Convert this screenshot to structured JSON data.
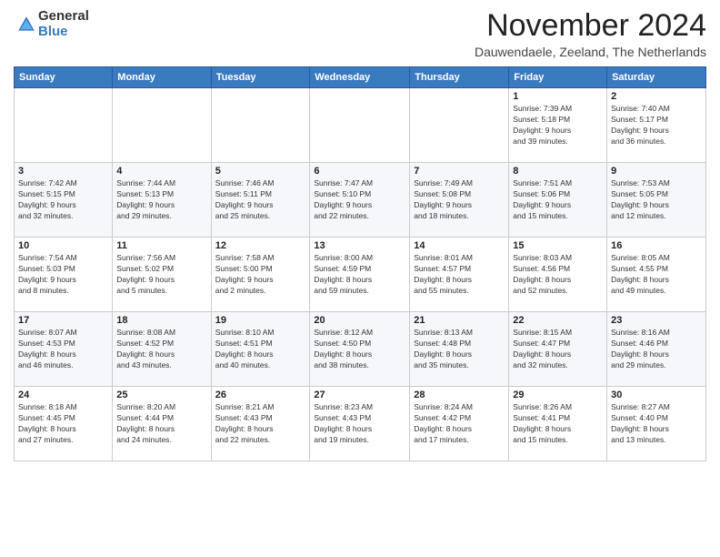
{
  "logo": {
    "general": "General",
    "blue": "Blue"
  },
  "header": {
    "month": "November 2024",
    "location": "Dauwendaele, Zeeland, The Netherlands"
  },
  "weekdays": [
    "Sunday",
    "Monday",
    "Tuesday",
    "Wednesday",
    "Thursday",
    "Friday",
    "Saturday"
  ],
  "weeks": [
    [
      {
        "day": "",
        "info": ""
      },
      {
        "day": "",
        "info": ""
      },
      {
        "day": "",
        "info": ""
      },
      {
        "day": "",
        "info": ""
      },
      {
        "day": "",
        "info": ""
      },
      {
        "day": "1",
        "info": "Sunrise: 7:39 AM\nSunset: 5:18 PM\nDaylight: 9 hours\nand 39 minutes."
      },
      {
        "day": "2",
        "info": "Sunrise: 7:40 AM\nSunset: 5:17 PM\nDaylight: 9 hours\nand 36 minutes."
      }
    ],
    [
      {
        "day": "3",
        "info": "Sunrise: 7:42 AM\nSunset: 5:15 PM\nDaylight: 9 hours\nand 32 minutes."
      },
      {
        "day": "4",
        "info": "Sunrise: 7:44 AM\nSunset: 5:13 PM\nDaylight: 9 hours\nand 29 minutes."
      },
      {
        "day": "5",
        "info": "Sunrise: 7:46 AM\nSunset: 5:11 PM\nDaylight: 9 hours\nand 25 minutes."
      },
      {
        "day": "6",
        "info": "Sunrise: 7:47 AM\nSunset: 5:10 PM\nDaylight: 9 hours\nand 22 minutes."
      },
      {
        "day": "7",
        "info": "Sunrise: 7:49 AM\nSunset: 5:08 PM\nDaylight: 9 hours\nand 18 minutes."
      },
      {
        "day": "8",
        "info": "Sunrise: 7:51 AM\nSunset: 5:06 PM\nDaylight: 9 hours\nand 15 minutes."
      },
      {
        "day": "9",
        "info": "Sunrise: 7:53 AM\nSunset: 5:05 PM\nDaylight: 9 hours\nand 12 minutes."
      }
    ],
    [
      {
        "day": "10",
        "info": "Sunrise: 7:54 AM\nSunset: 5:03 PM\nDaylight: 9 hours\nand 8 minutes."
      },
      {
        "day": "11",
        "info": "Sunrise: 7:56 AM\nSunset: 5:02 PM\nDaylight: 9 hours\nand 5 minutes."
      },
      {
        "day": "12",
        "info": "Sunrise: 7:58 AM\nSunset: 5:00 PM\nDaylight: 9 hours\nand 2 minutes."
      },
      {
        "day": "13",
        "info": "Sunrise: 8:00 AM\nSunset: 4:59 PM\nDaylight: 8 hours\nand 59 minutes."
      },
      {
        "day": "14",
        "info": "Sunrise: 8:01 AM\nSunset: 4:57 PM\nDaylight: 8 hours\nand 55 minutes."
      },
      {
        "day": "15",
        "info": "Sunrise: 8:03 AM\nSunset: 4:56 PM\nDaylight: 8 hours\nand 52 minutes."
      },
      {
        "day": "16",
        "info": "Sunrise: 8:05 AM\nSunset: 4:55 PM\nDaylight: 8 hours\nand 49 minutes."
      }
    ],
    [
      {
        "day": "17",
        "info": "Sunrise: 8:07 AM\nSunset: 4:53 PM\nDaylight: 8 hours\nand 46 minutes."
      },
      {
        "day": "18",
        "info": "Sunrise: 8:08 AM\nSunset: 4:52 PM\nDaylight: 8 hours\nand 43 minutes."
      },
      {
        "day": "19",
        "info": "Sunrise: 8:10 AM\nSunset: 4:51 PM\nDaylight: 8 hours\nand 40 minutes."
      },
      {
        "day": "20",
        "info": "Sunrise: 8:12 AM\nSunset: 4:50 PM\nDaylight: 8 hours\nand 38 minutes."
      },
      {
        "day": "21",
        "info": "Sunrise: 8:13 AM\nSunset: 4:48 PM\nDaylight: 8 hours\nand 35 minutes."
      },
      {
        "day": "22",
        "info": "Sunrise: 8:15 AM\nSunset: 4:47 PM\nDaylight: 8 hours\nand 32 minutes."
      },
      {
        "day": "23",
        "info": "Sunrise: 8:16 AM\nSunset: 4:46 PM\nDaylight: 8 hours\nand 29 minutes."
      }
    ],
    [
      {
        "day": "24",
        "info": "Sunrise: 8:18 AM\nSunset: 4:45 PM\nDaylight: 8 hours\nand 27 minutes."
      },
      {
        "day": "25",
        "info": "Sunrise: 8:20 AM\nSunset: 4:44 PM\nDaylight: 8 hours\nand 24 minutes."
      },
      {
        "day": "26",
        "info": "Sunrise: 8:21 AM\nSunset: 4:43 PM\nDaylight: 8 hours\nand 22 minutes."
      },
      {
        "day": "27",
        "info": "Sunrise: 8:23 AM\nSunset: 4:43 PM\nDaylight: 8 hours\nand 19 minutes."
      },
      {
        "day": "28",
        "info": "Sunrise: 8:24 AM\nSunset: 4:42 PM\nDaylight: 8 hours\nand 17 minutes."
      },
      {
        "day": "29",
        "info": "Sunrise: 8:26 AM\nSunset: 4:41 PM\nDaylight: 8 hours\nand 15 minutes."
      },
      {
        "day": "30",
        "info": "Sunrise: 8:27 AM\nSunset: 4:40 PM\nDaylight: 8 hours\nand 13 minutes."
      }
    ]
  ]
}
